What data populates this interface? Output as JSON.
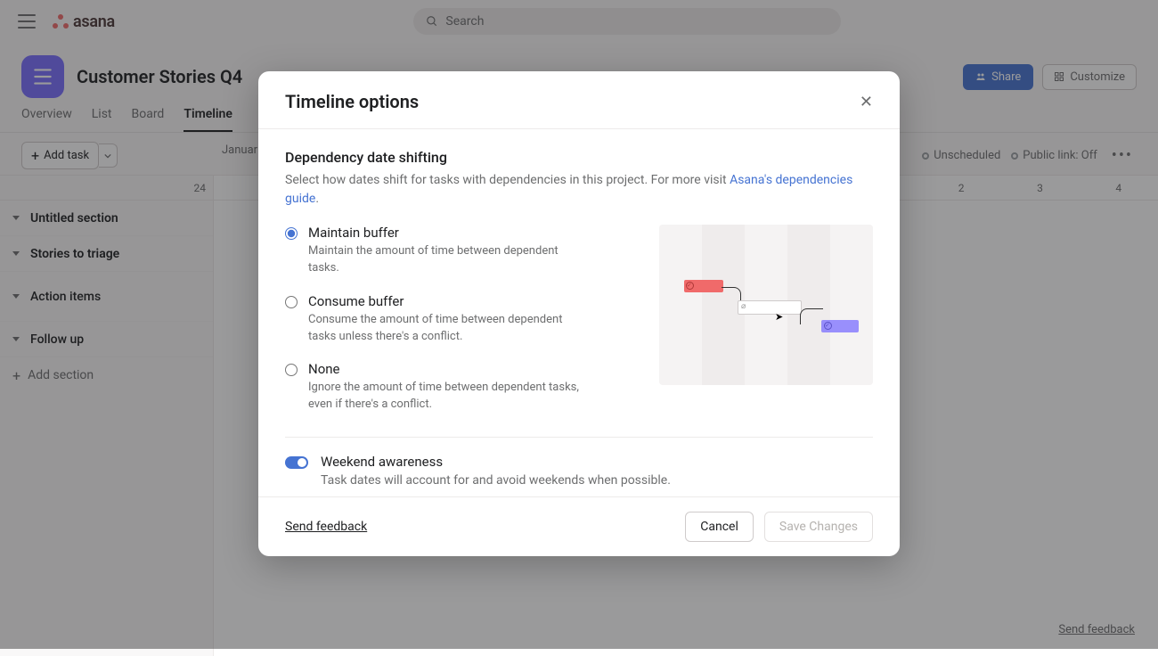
{
  "topbar": {
    "search_placeholder": "Search",
    "logo_text": "asana"
  },
  "header": {
    "page_title": "Customer Stories Q4",
    "share_label": "Share",
    "customize_label": "Customize"
  },
  "tabs": {
    "overview": "Overview",
    "list": "List",
    "board": "Board",
    "timeline": "Timeline"
  },
  "toolbar": {
    "add_task": "Add task",
    "month": "Januar",
    "unscheduled": "Unscheduled",
    "public_link": "Public link: Off",
    "dates": {
      "d24": "24",
      "d2": "2",
      "d3": "3",
      "d4": "4"
    }
  },
  "sidebar": {
    "sections": {
      "untitled": "Untitled section",
      "triage": "Stories to triage",
      "action": "Action items",
      "followup": "Follow up"
    },
    "add_section": "Add section"
  },
  "modal": {
    "title": "Timeline options",
    "section_title": "Dependency date shifting",
    "section_desc_before": "Select how dates shift for tasks with dependencies in this project. For more visit ",
    "section_desc_link": "Asana's dependencies guide",
    "section_desc_after": ".",
    "opt1_title": "Maintain buffer",
    "opt1_desc": "Maintain the amount of time between dependent tasks.",
    "opt2_title": "Consume buffer",
    "opt2_desc": "Consume the amount of time between dependent tasks unless there's a conflict.",
    "opt3_title": "None",
    "opt3_desc": "Ignore the amount of time between dependent tasks, even if there's a conflict.",
    "weekend_title": "Weekend awareness",
    "weekend_desc": "Task dates will account for and avoid weekends when possible.",
    "cancel": "Cancel",
    "save": "Save Changes",
    "send_feedback": "Send feedback",
    "selected_option": "maintain",
    "weekend_on": true
  },
  "global": {
    "send_feedback": "Send feedback"
  }
}
